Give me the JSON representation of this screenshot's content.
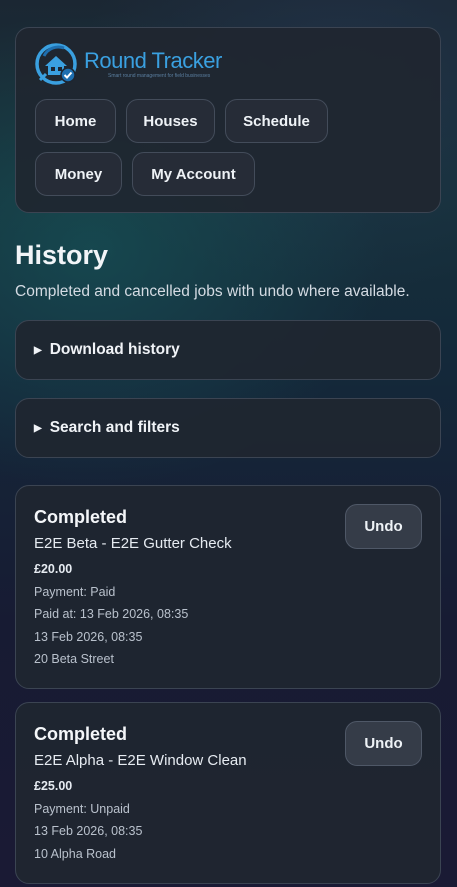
{
  "brand": {
    "name": "Round Tracker",
    "tagline": "Smart round management for field businesses",
    "colors": {
      "primary": "#3aa0e0",
      "dark": "#1e6fb0"
    }
  },
  "nav": {
    "items": [
      {
        "label": "Home"
      },
      {
        "label": "Houses"
      },
      {
        "label": "Schedule"
      },
      {
        "label": "Money"
      },
      {
        "label": "My Account"
      }
    ]
  },
  "page": {
    "title": "History",
    "subtitle": "Completed and cancelled jobs with undo where available."
  },
  "sections": {
    "download": {
      "label": "Download history",
      "icon": "disclosure-triangle-icon"
    },
    "filters": {
      "label": "Search and filters",
      "icon": "disclosure-triangle-icon"
    }
  },
  "jobs": [
    {
      "status": "Completed",
      "title": "E2E Beta - E2E Gutter Check",
      "price": "£20.00",
      "payment": "Payment: Paid",
      "paid_at": "Paid at: 13 Feb 2026, 08:35",
      "date": "13 Feb 2026, 08:35",
      "address": "20 Beta Street",
      "undo_label": "Undo"
    },
    {
      "status": "Completed",
      "title": "E2E Alpha - E2E Window Clean",
      "price": "£25.00",
      "payment": "Payment: Unpaid",
      "date": "13 Feb 2026, 08:35",
      "address": "10 Alpha Road",
      "undo_label": "Undo"
    }
  ]
}
